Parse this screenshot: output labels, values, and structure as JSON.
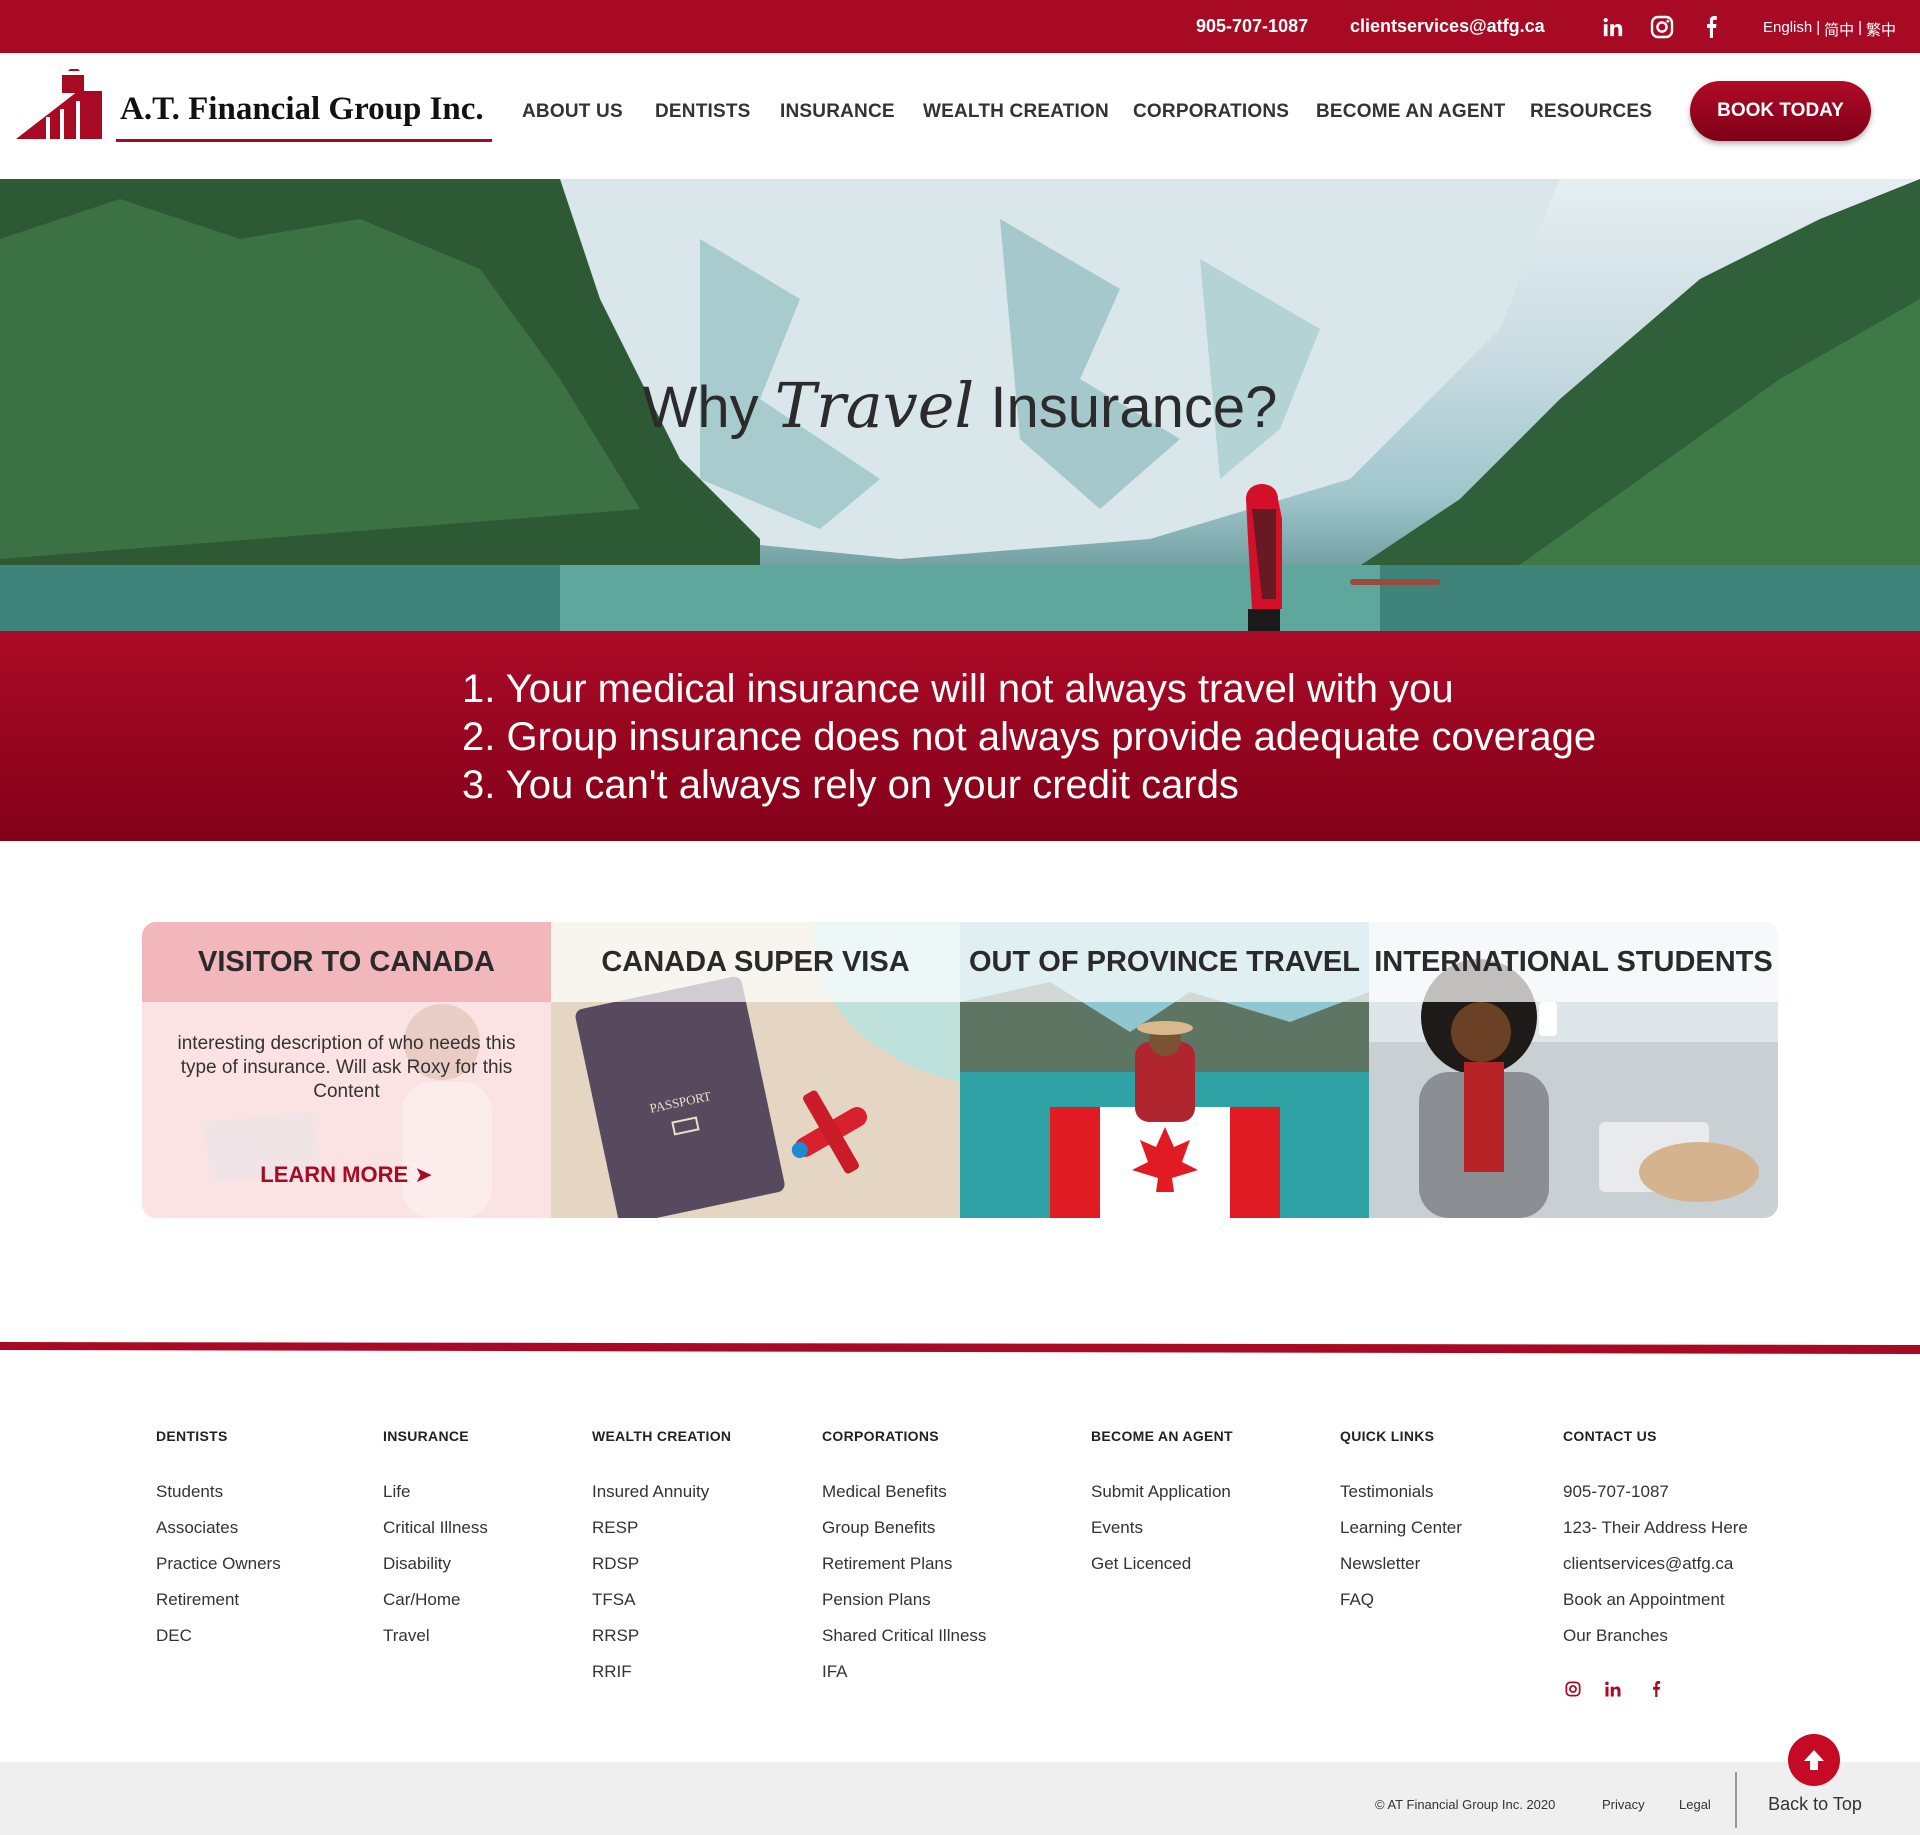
{
  "topbar": {
    "phone": "905-707-1087",
    "email": "clientservices@atfg.ca",
    "social_icons": [
      "linkedin-icon",
      "instagram-icon",
      "facebook-icon"
    ],
    "lang_en": "English",
    "sep1": "|",
    "lang_sc": "简中",
    "sep2": "|",
    "lang_tc": "繁中"
  },
  "header": {
    "logo_text": "A.T. Financial Group Inc.",
    "nav": [
      "ABOUT US",
      "DENTISTS",
      "INSURANCE",
      "WEALTH CREATION",
      "CORPORATIONS",
      "BECOME AN AGENT",
      "RESOURCES"
    ],
    "book_button": "BOOK TODAY"
  },
  "hero": {
    "title_pre": "Why",
    "title_em": "Travel",
    "title_post": "Insurance?"
  },
  "reasons": [
    "1. Your medical insurance will not always travel with you",
    "2. Group insurance does not always provide adequate coverage",
    "3. You can't always rely on your credit cards"
  ],
  "cards": [
    {
      "title": "VISITOR TO CANADA",
      "description": "interesting description of who needs this type of insurance. Will ask Roxy for this Content",
      "link": "LEARN MORE"
    },
    {
      "title": "CANADA SUPER VISA",
      "image_text": "PASSPORT"
    },
    {
      "title": "OUT OF PROVINCE TRAVEL"
    },
    {
      "title": "INTERNATIONAL STUDENTS"
    }
  ],
  "footer": {
    "columns": [
      {
        "heading": "DENTISTS",
        "links": [
          "Students",
          "Associates",
          "Practice Owners",
          "Retirement",
          "DEC"
        ]
      },
      {
        "heading": "INSURANCE",
        "links": [
          "Life",
          "Critical Illness",
          "Disability",
          "Car/Home",
          "Travel"
        ]
      },
      {
        "heading": "WEALTH CREATION",
        "links": [
          "Insured Annuity",
          "RESP",
          "RDSP",
          "TFSA",
          "RRSP",
          "RRIF"
        ]
      },
      {
        "heading": "CORPORATIONS",
        "links": [
          "Medical Benefits",
          "Group Benefits",
          "Retirement Plans",
          "Pension Plans",
          "Shared Critical Illness",
          "IFA"
        ]
      },
      {
        "heading": "BECOME AN AGENT",
        "links": [
          "Submit Application",
          "Events",
          "Get Licenced"
        ]
      },
      {
        "heading": "QUICK LINKS",
        "links": [
          "Testimonials",
          "Learning Center",
          "Newsletter",
          "FAQ"
        ]
      },
      {
        "heading": "CONTACT US",
        "links": [
          "905-707-1087",
          "123- Their Address Here",
          "clientservices@atfg.ca",
          "Book an Appointment",
          "Our Branches"
        ]
      }
    ],
    "social_icons": [
      "instagram-icon",
      "linkedin-icon",
      "facebook-icon"
    ],
    "copyright": "© AT Financial Group Inc. 2020",
    "privacy": "Privacy",
    "legal": "Legal",
    "back_to_top": "Back to Top"
  },
  "colors": {
    "brand": "#a80a24",
    "brand_dark": "#7d0016",
    "card_head": "#f2b7bb",
    "card_body": "#fbe2e3"
  }
}
